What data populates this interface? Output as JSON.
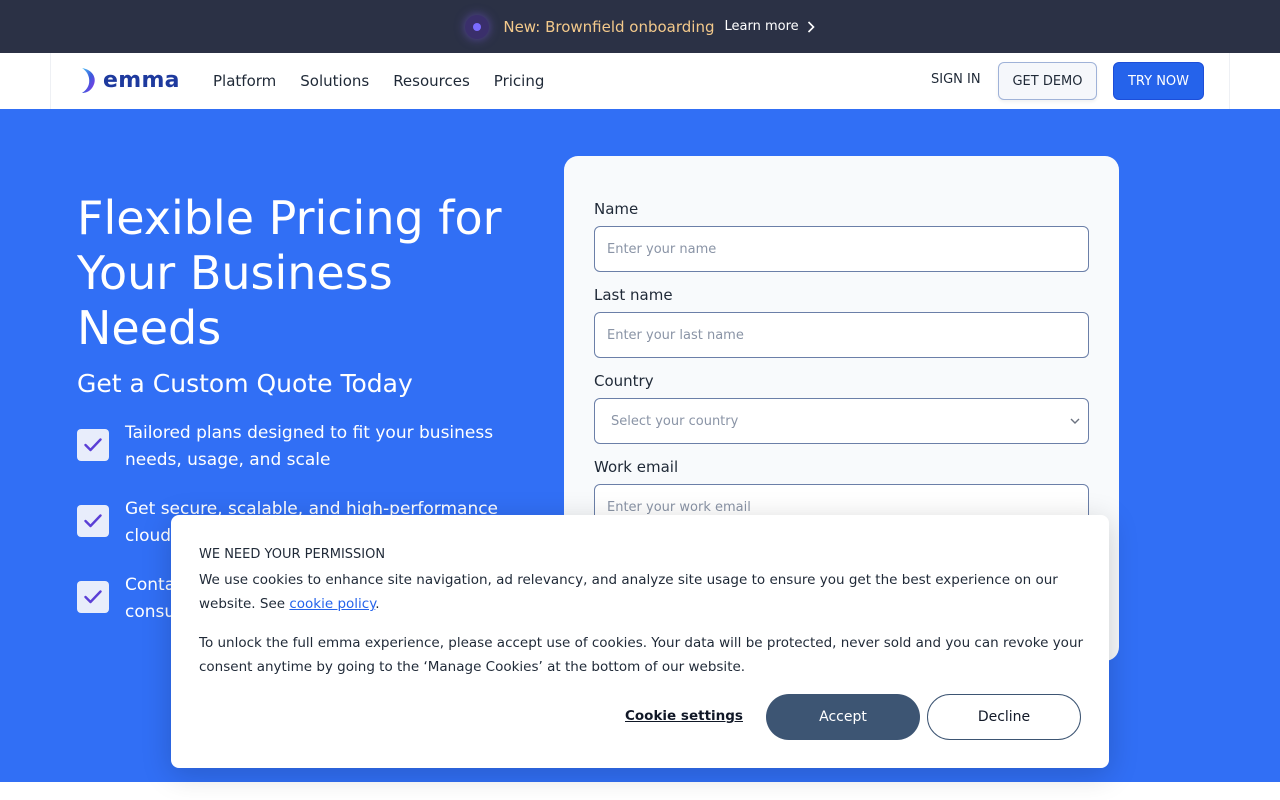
{
  "announcement": {
    "icon": "sparkle-dot-icon",
    "text": "New: Brownfield onboarding",
    "link_label": "Learn more"
  },
  "nav": {
    "logo_text": "emma",
    "menu": [
      "Platform",
      "Solutions",
      "Resources",
      "Pricing"
    ],
    "sign_in": "SIGN IN",
    "get_demo": "GET DEMO",
    "try_now": "TRY NOW"
  },
  "hero": {
    "title": "Flexible Pricing for Your Business Needs",
    "subtitle": "Get a Custom Quote Today",
    "features": [
      "Tailored plans designed to fit your business needs, usage, and scale",
      "Get secure, scalable, and high-performance cloud",
      "Conta consu"
    ]
  },
  "form": {
    "name_label": "Name",
    "name_placeholder": "Enter your name",
    "last_name_label": "Last name",
    "last_name_placeholder": "Enter your last name",
    "country_label": "Country",
    "country_placeholder": "Select your country",
    "work_email_label": "Work email",
    "work_email_placeholder": "Enter your work email"
  },
  "cookie": {
    "heading": "WE NEED YOUR PERMISSION",
    "para1": "We use cookies to enhance site navigation, ad relevancy, and analyze site usage to ensure you get the best experience on our website. See ",
    "policy_link": "cookie policy",
    "para1_end": ".",
    "para2": "To unlock the full emma experience, please accept use of cookies. Your data will be protected, never sold and you can revoke your consent anytime by going to the ‘Manage Cookies’ at the bottom of our website.",
    "settings_label": "Cookie settings",
    "accept_label": "Accept",
    "decline_label": "Decline"
  },
  "colors": {
    "hero_bg": "#316ff5",
    "announce_bg": "#2b3145",
    "accent_blue": "#2563eb",
    "accept_bg": "#3d5573"
  }
}
